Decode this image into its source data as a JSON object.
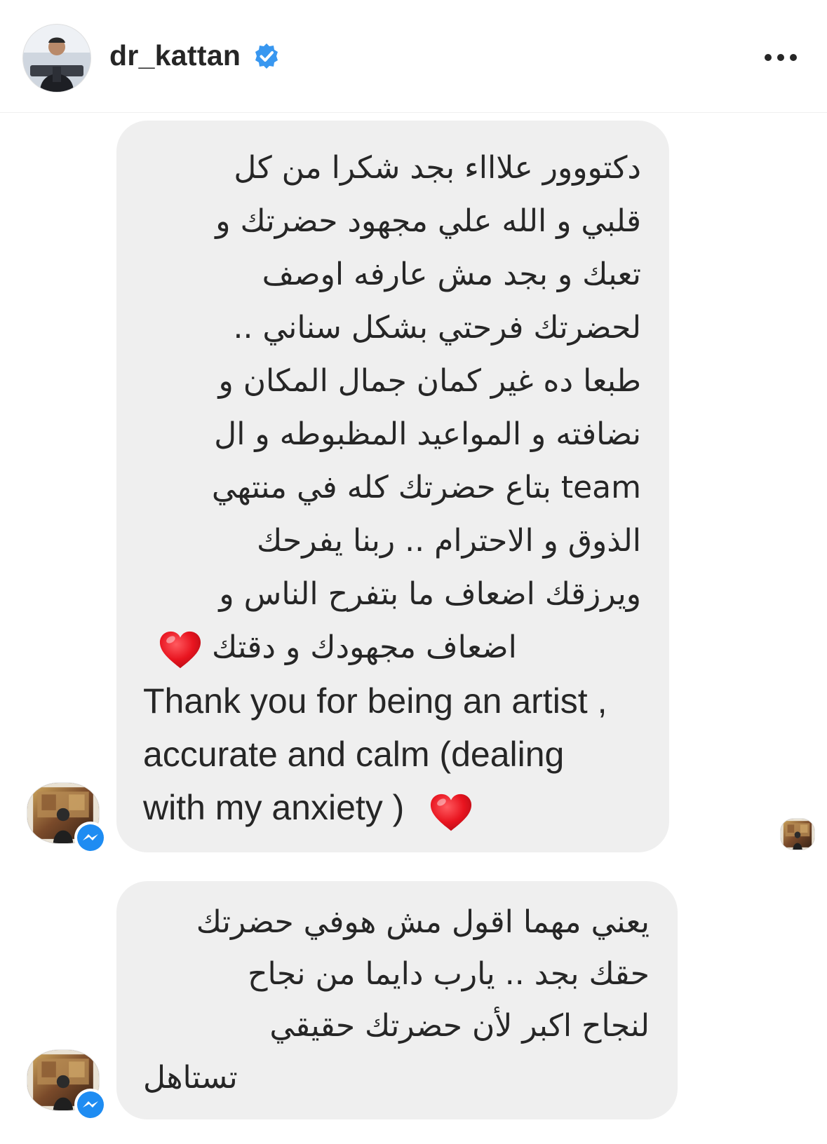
{
  "header": {
    "username": "dr_kattan",
    "verified_icon": "verified-badge-icon",
    "more_icon": "more-horizontal-icon"
  },
  "messages": [
    {
      "sender_avatar_icon": "sender-avatar-painting",
      "badge_icon": "messenger-icon",
      "lines": [
        "دكتووور علاااء بجد شكرا من كل",
        "قلبي و الله علي مجهود حضرتك و",
        "تعبك و بجد مش عارفه اوصف",
        "لحضرتك فرحتي بشكل سناني  ..",
        "طبعا ده غير كمان جمال المكان و",
        "نضافته و المواعيد المظبوطه و ال",
        "team بتاع حضرتك كله في منتهي",
        "الذوق و الاحترام .. ربنا يفرحك",
        "ويرزقك اضعاف ما بتفرح الناس و",
        "اضعاف مجهودك و دقتك",
        "Thank you for being an artist ,",
        "accurate and calm (dealing",
        "with my anxiety )"
      ],
      "emoji": "❤️"
    },
    {
      "sender_avatar_icon": "sender-avatar-painting",
      "badge_icon": "messenger-icon",
      "lines": [
        "يعني مهما اقول مش هوفي حضرتك",
        "حقك بجد .. يارب دايما من نجاح",
        "لنجاح اكبر لأن حضرتك حقيقي",
        "تستاهل"
      ]
    }
  ],
  "seen_indicator_icon": "seen-avatar-icon",
  "colors": {
    "bubble": "#efefef",
    "text": "#262626",
    "verified": "#3897f0",
    "messenger": "#1e8cf2",
    "heart": "#e8141f"
  }
}
